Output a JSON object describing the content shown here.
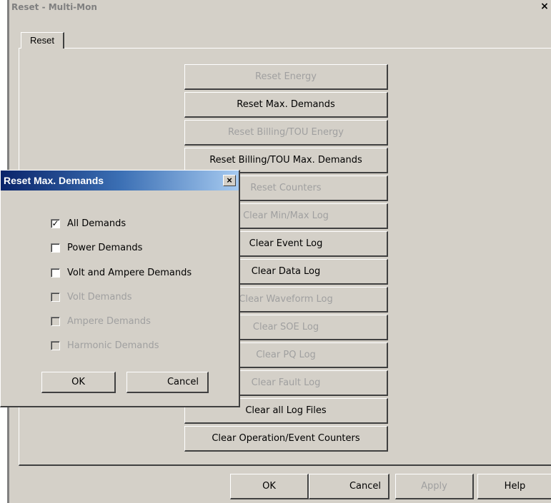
{
  "window": {
    "title": "Reset - Multi-Mon",
    "close_glyph": "×"
  },
  "tab": {
    "label": "Reset"
  },
  "buttons": [
    {
      "label": "Reset Energy",
      "enabled": false
    },
    {
      "label": "Reset Max. Demands",
      "enabled": true
    },
    {
      "label": "Reset Billing/TOU Energy",
      "enabled": false
    },
    {
      "label": "Reset Billing/TOU Max. Demands",
      "enabled": true
    },
    {
      "label": "Reset Counters",
      "enabled": false
    },
    {
      "label": "Clear Min/Max Log",
      "enabled": false
    },
    {
      "label": "Clear Event Log",
      "enabled": true
    },
    {
      "label": "Clear Data Log",
      "enabled": true
    },
    {
      "label": "Clear Waveform Log",
      "enabled": false
    },
    {
      "label": "Clear SOE Log",
      "enabled": false
    },
    {
      "label": "Clear PQ Log",
      "enabled": false
    },
    {
      "label": "Clear Fault Log",
      "enabled": false
    },
    {
      "label": "Clear all Log Files",
      "enabled": true
    },
    {
      "label": "Clear Operation/Event Counters",
      "enabled": true
    }
  ],
  "dialog": {
    "title": "Reset Max. Demands",
    "close_glyph": "×",
    "options": [
      {
        "label": "All Demands",
        "checked": true,
        "enabled": true
      },
      {
        "label": "Power Demands",
        "checked": false,
        "enabled": true
      },
      {
        "label": "Volt and Ampere Demands",
        "checked": false,
        "enabled": true
      },
      {
        "label": "Volt Demands",
        "checked": false,
        "enabled": false
      },
      {
        "label": "Ampere Demands",
        "checked": false,
        "enabled": false
      },
      {
        "label": "Harmonic Demands",
        "checked": false,
        "enabled": false
      }
    ],
    "ok_label": "OK",
    "cancel_label": "Cancel"
  },
  "footer": {
    "ok_label": "OK",
    "cancel_label": "Cancel",
    "apply_label": "Apply",
    "apply_enabled": false,
    "help_label": "Help"
  }
}
